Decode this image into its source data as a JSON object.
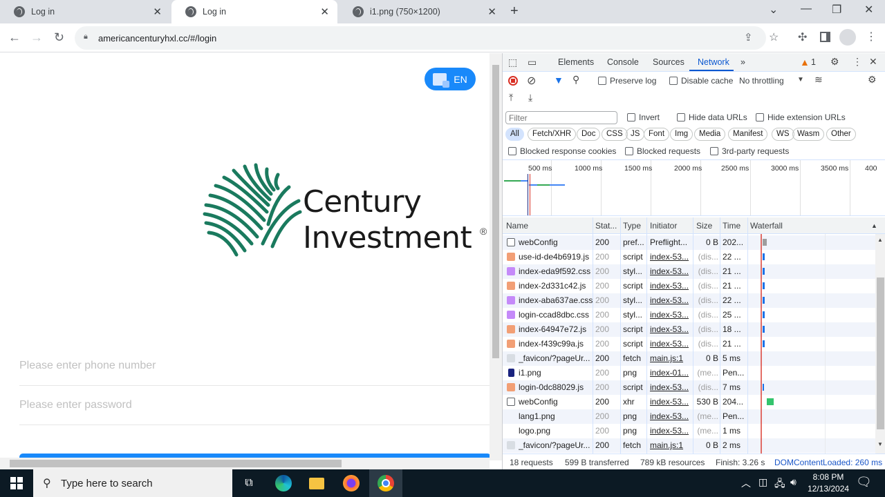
{
  "browser": {
    "tabs": [
      {
        "title": "Log in",
        "active": false
      },
      {
        "title": "Log in",
        "active": true
      },
      {
        "title": "i1.png (750×1200)",
        "active": false
      }
    ],
    "new_tab": "+",
    "url": "americancenturyhxl.cc/#/login",
    "window_controls": {
      "tab_search": "⌄",
      "minimize": "—",
      "restore": "❐",
      "close": "✕"
    }
  },
  "page": {
    "lang_button": "EN",
    "logo": {
      "line1": "Century",
      "line2": "Investment",
      "reg": "®",
      "brand_color": "#1a7a5e"
    },
    "phone_placeholder": "Please enter phone number",
    "password_placeholder": "Please enter password",
    "accent_color": "#1989fa"
  },
  "devtools": {
    "tabs": [
      "Elements",
      "Console",
      "Sources",
      "Network"
    ],
    "active_tab": "Network",
    "more_tabs": "»",
    "warnings_count": "1",
    "toolbar": {
      "preserve_log": "Preserve log",
      "disable_cache": "Disable cache",
      "throttling": "No throttling"
    },
    "filter": {
      "placeholder": "Filter",
      "invert": "Invert",
      "hide_data_urls": "Hide data URLs",
      "hide_extension_urls": "Hide extension URLs",
      "chips": [
        "All",
        "Fetch/XHR",
        "Doc",
        "CSS",
        "JS",
        "Font",
        "Img",
        "Media",
        "Manifest",
        "WS",
        "Wasm",
        "Other"
      ],
      "blocked_response_cookies": "Blocked response cookies",
      "blocked_requests": "Blocked requests",
      "third_party_requests": "3rd-party requests"
    },
    "overview_ticks": [
      "500 ms",
      "1000 ms",
      "1500 ms",
      "2000 ms",
      "2500 ms",
      "3000 ms",
      "3500 ms",
      "400"
    ],
    "columns": [
      "Name",
      "Stat...",
      "Type",
      "Initiator",
      "Size",
      "Time",
      "Waterfall"
    ],
    "rows": [
      {
        "icon": "doc",
        "name": "webConfig",
        "status": "200",
        "type": "pref...",
        "initiator": "Preflight...",
        "size": "0 B",
        "time": "202...",
        "dim": false,
        "link": false
      },
      {
        "icon": "js",
        "name": "use-id-de4b6919.js",
        "status": "200",
        "type": "script",
        "initiator": "index-53...",
        "size": "(dis...",
        "time": "22 ...",
        "dim": true,
        "link": true
      },
      {
        "icon": "css",
        "name": "index-eda9f592.css",
        "status": "200",
        "type": "styl...",
        "initiator": "index-53...",
        "size": "(dis...",
        "time": "21 ...",
        "dim": true,
        "link": true
      },
      {
        "icon": "js",
        "name": "index-2d331c42.js",
        "status": "200",
        "type": "script",
        "initiator": "index-53...",
        "size": "(dis...",
        "time": "21 ...",
        "dim": true,
        "link": true
      },
      {
        "icon": "css",
        "name": "index-aba637ae.css",
        "status": "200",
        "type": "styl...",
        "initiator": "index-53...",
        "size": "(dis...",
        "time": "22 ...",
        "dim": true,
        "link": true
      },
      {
        "icon": "css",
        "name": "login-ccad8dbc.css",
        "status": "200",
        "type": "styl...",
        "initiator": "index-53...",
        "size": "(dis...",
        "time": "25 ...",
        "dim": true,
        "link": true
      },
      {
        "icon": "js",
        "name": "index-64947e72.js",
        "status": "200",
        "type": "script",
        "initiator": "index-53...",
        "size": "(dis...",
        "time": "18 ...",
        "dim": true,
        "link": true
      },
      {
        "icon": "js",
        "name": "index-f439c99a.js",
        "status": "200",
        "type": "script",
        "initiator": "index-53...",
        "size": "(dis...",
        "time": "21 ...",
        "dim": true,
        "link": true
      },
      {
        "icon": "img",
        "name": "_favicon/?pageUr...",
        "status": "200",
        "type": "fetch",
        "initiator": "main.js:1",
        "size": "0 B",
        "time": "5 ms",
        "dim": false,
        "link": true
      },
      {
        "icon": "dark",
        "name": "i1.png",
        "status": "200",
        "type": "png",
        "initiator": "index-01...",
        "size": "(me...",
        "time": "Pen...",
        "dim": true,
        "link": true
      },
      {
        "icon": "js",
        "name": "login-0dc88029.js",
        "status": "200",
        "type": "script",
        "initiator": "index-53...",
        "size": "(dis...",
        "time": "7 ms",
        "dim": true,
        "link": true
      },
      {
        "icon": "doc",
        "name": "webConfig",
        "status": "200",
        "type": "xhr",
        "initiator": "index-53...",
        "size": "530 B",
        "time": "204...",
        "dim": false,
        "link": true
      },
      {
        "icon": "none",
        "name": "lang1.png",
        "status": "200",
        "type": "png",
        "initiator": "index-53...",
        "size": "(me...",
        "time": "Pen...",
        "dim": true,
        "link": true
      },
      {
        "icon": "none",
        "name": "logo.png",
        "status": "200",
        "type": "png",
        "initiator": "index-53...",
        "size": "(me...",
        "time": "1 ms",
        "dim": true,
        "link": true
      },
      {
        "icon": "img",
        "name": "_favicon/?pageUr...",
        "status": "200",
        "type": "fetch",
        "initiator": "main.js:1",
        "size": "0 B",
        "time": "2 ms",
        "dim": false,
        "link": true
      }
    ],
    "status_bar": {
      "requests": "18 requests",
      "transferred": "599 B transferred",
      "resources": "789 kB resources",
      "finish": "Finish: 3.26 s",
      "dom_content_loaded": "DOMContentLoaded: 260 ms"
    }
  },
  "taskbar": {
    "search_placeholder": "Type here to search",
    "time": "8:08 PM",
    "date": "12/13/2024"
  }
}
